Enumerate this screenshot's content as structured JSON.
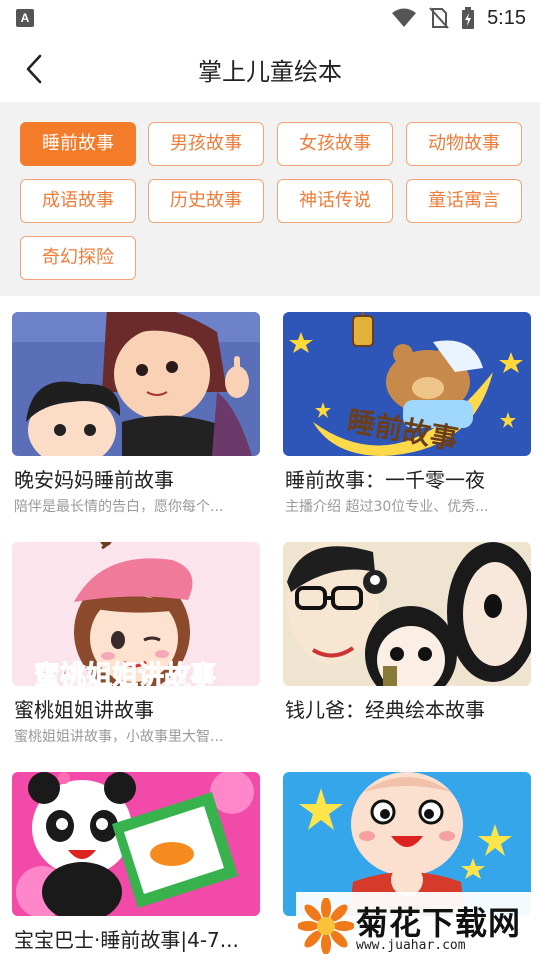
{
  "status": {
    "app_badge": "A",
    "time": "5:15",
    "icons": [
      "wifi-icon",
      "no-sim-icon",
      "battery-charging-icon"
    ]
  },
  "header": {
    "title": "掌上儿童绘本",
    "back_icon": "chevron-left-icon"
  },
  "tags": [
    {
      "label": "睡前故事",
      "active": true
    },
    {
      "label": "男孩故事",
      "active": false
    },
    {
      "label": "女孩故事",
      "active": false
    },
    {
      "label": "动物故事",
      "active": false
    },
    {
      "label": "成语故事",
      "active": false
    },
    {
      "label": "历史故事",
      "active": false
    },
    {
      "label": "神话传说",
      "active": false
    },
    {
      "label": "童话寓言",
      "active": false
    },
    {
      "label": "奇幻探险",
      "active": false
    }
  ],
  "cards": [
    {
      "title": "晚安妈妈睡前故事",
      "desc": "陪伴是最长情的告白，愿你每个..."
    },
    {
      "title": "睡前故事：一千零一夜",
      "desc": "主播介绍 超过30位专业、优秀..."
    },
    {
      "title": "蜜桃姐姐讲故事",
      "desc": "蜜桃姐姐讲故事，小故事里大智..."
    },
    {
      "title": "钱儿爸：经典绘本故事",
      "desc": ""
    },
    {
      "title": "宝宝巴士·睡前故事|4-7...",
      "desc": ""
    },
    {
      "title": "",
      "desc": ""
    }
  ],
  "thumb_texts": {
    "card2": "睡前故事",
    "card3": "蜜桃姐姐讲故事"
  },
  "watermark": {
    "name": "菊花下载网",
    "url": "www.juahar.com"
  },
  "colors": {
    "accent": "#f47b2a",
    "tag_text": "#ef7c3a",
    "tag_border": "#f0a477",
    "tag_bg_area": "#f2f2f2"
  }
}
